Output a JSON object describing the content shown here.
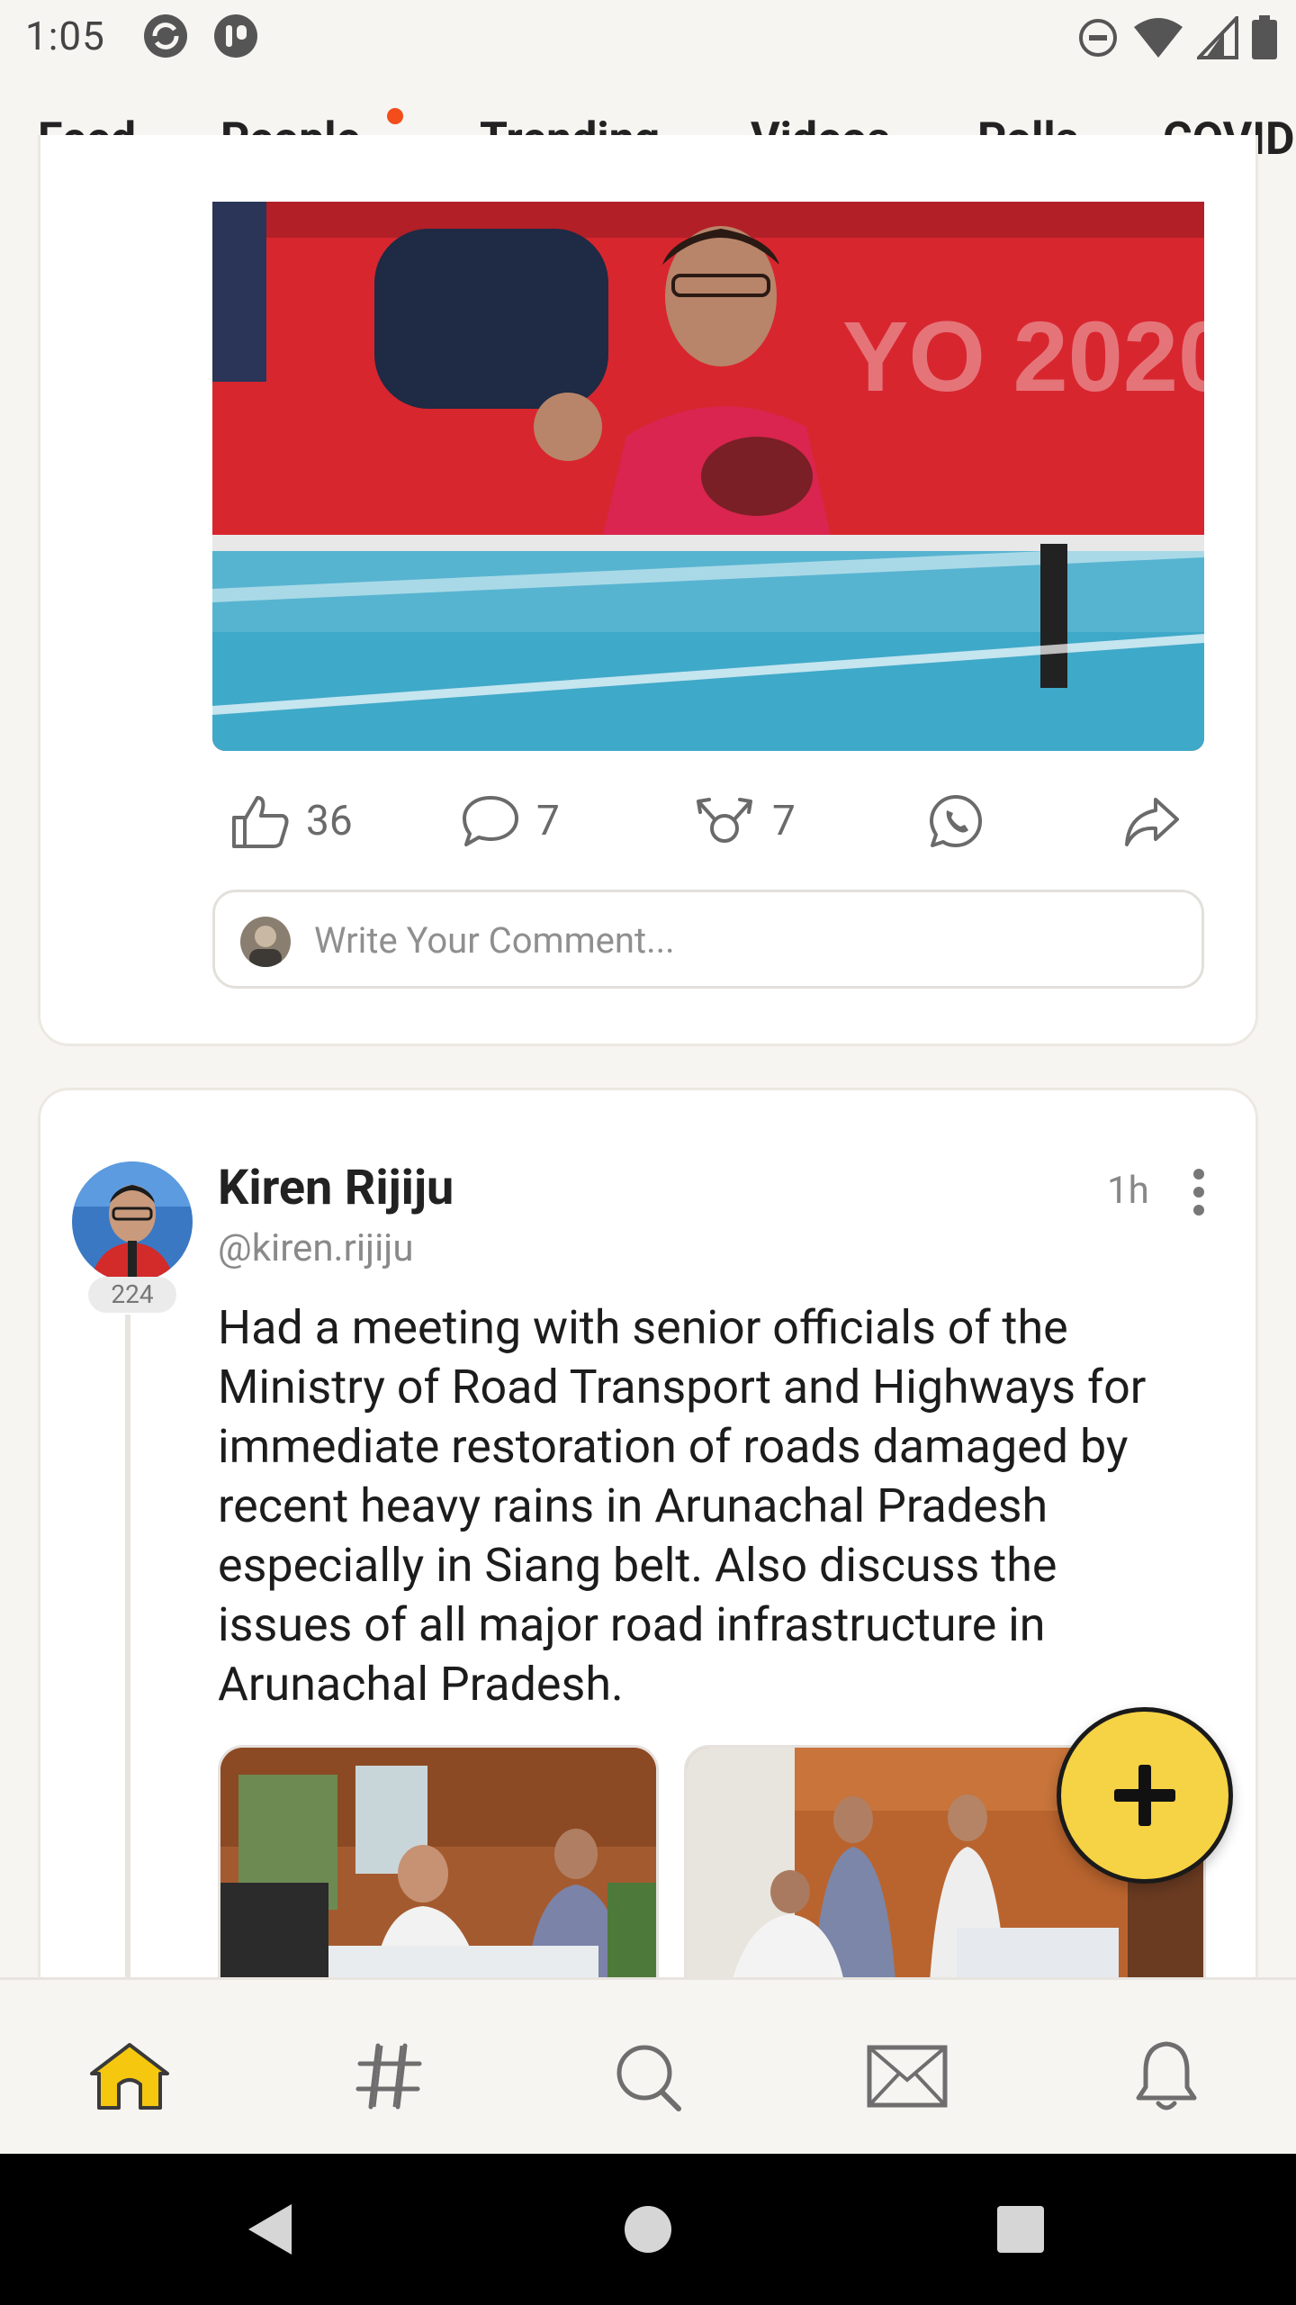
{
  "status_bar": {
    "time": "1:05",
    "icons": [
      "sync-app-icon",
      "app-notification-icon",
      "do-not-disturb-icon",
      "wifi-icon",
      "cellular-signal-icon",
      "battery-icon"
    ]
  },
  "tabs": [
    {
      "label": "Feed",
      "active": true
    },
    {
      "label": "People",
      "has_dot": true
    },
    {
      "label": "Trending"
    },
    {
      "label": "Videos"
    },
    {
      "label": "Polls"
    },
    {
      "label": "COVID"
    }
  ],
  "post1": {
    "likes": "36",
    "comments": "7",
    "reposts": "7",
    "comment_placeholder": "Write Your Comment..."
  },
  "post2": {
    "author_name": "Kiren Rijiju",
    "author_handle": "@kiren.rijiju",
    "badge_count": "224",
    "time_ago": "1h",
    "text": "Had a meeting with senior officials of the Ministry of Road Transport and Highways for immediate restoration of roads damaged by recent heavy rains in Arunachal Pradesh especially in Siang belt. Also discuss the issues of all major road infrastructure in Arunachal Pradesh."
  },
  "bottom_nav": [
    "home-icon",
    "hashtag-icon",
    "search-icon",
    "mail-icon",
    "bell-icon"
  ],
  "colors": {
    "accent": "#f5c80f",
    "fab": "#f6d245",
    "notification_dot": "#f24d1a",
    "background": "#f7f5f2"
  }
}
